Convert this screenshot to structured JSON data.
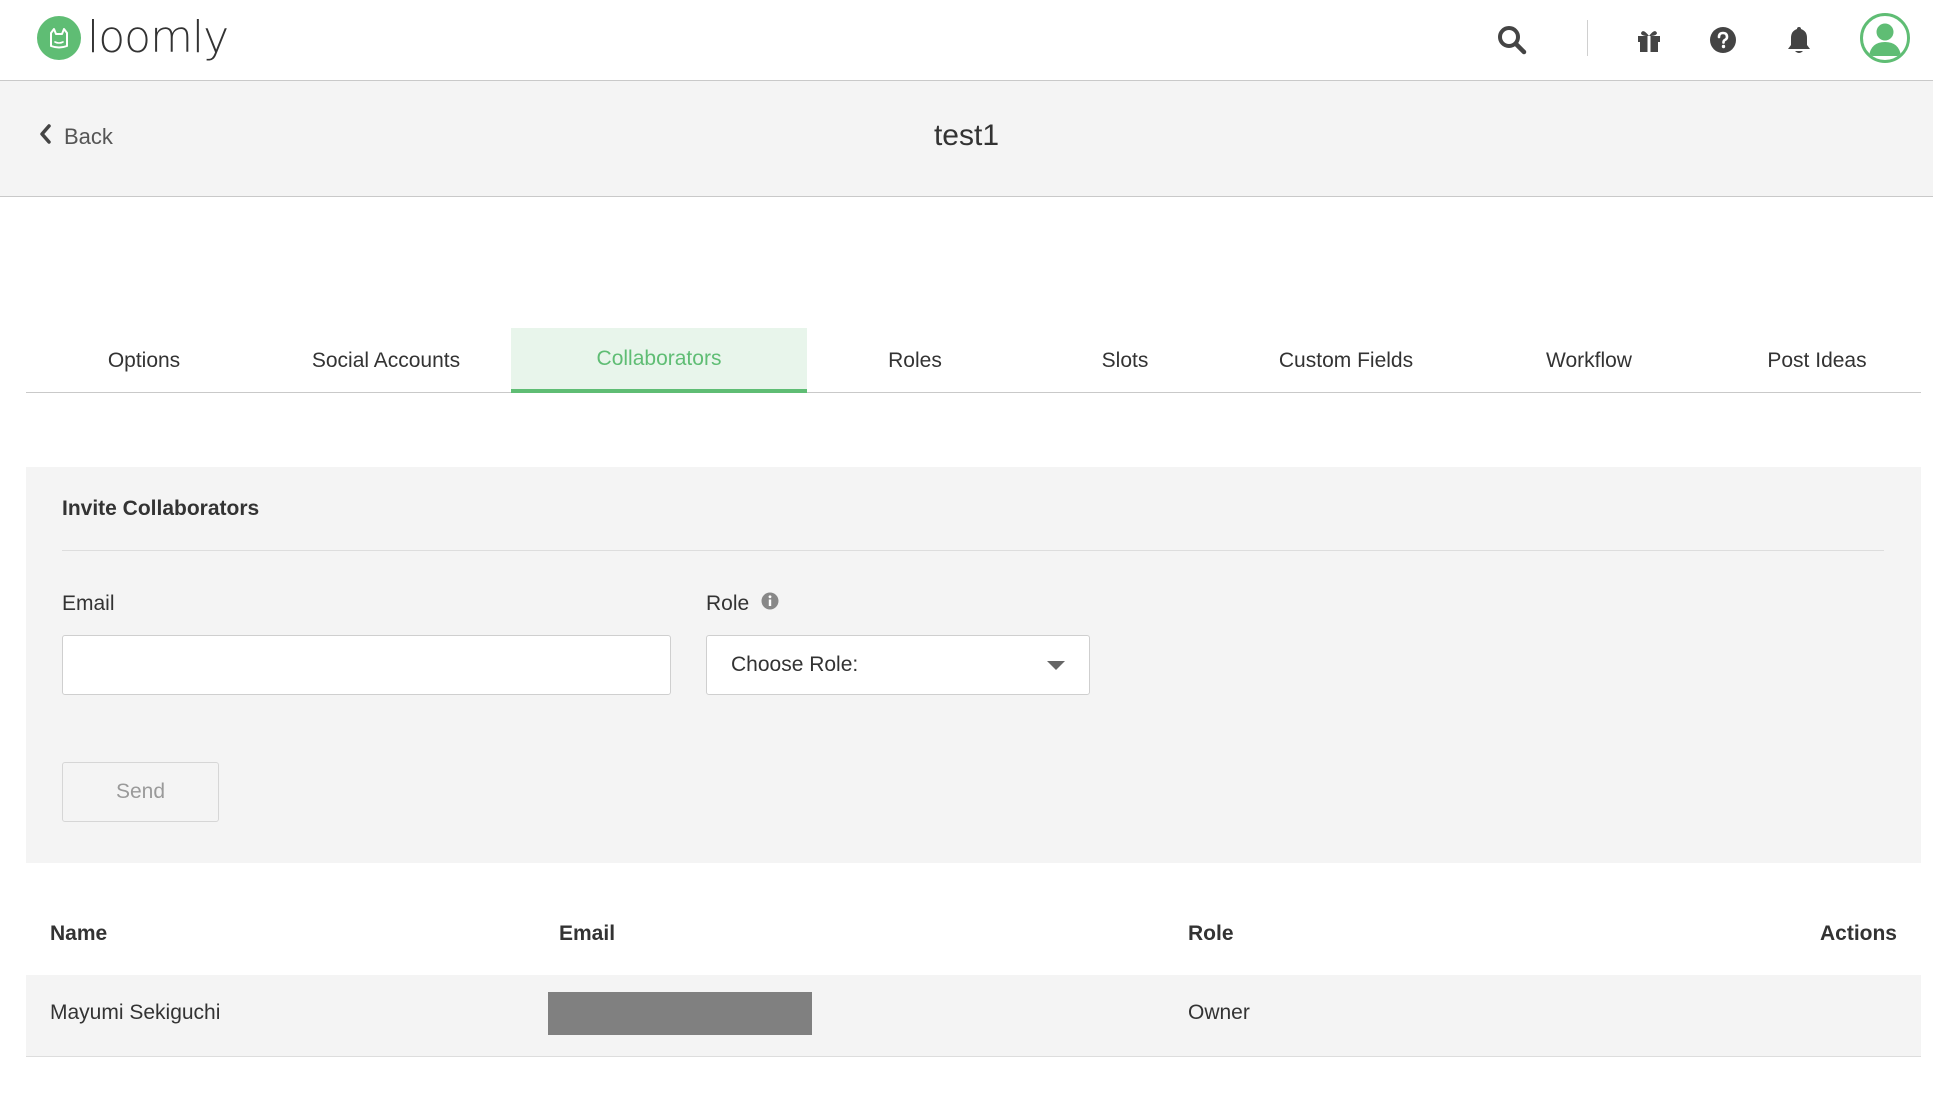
{
  "app": {
    "logo_text": "loomly",
    "brand_color": "#5fbd74"
  },
  "topbar": {
    "icons": [
      "search-icon",
      "gift-icon",
      "help-icon",
      "bell-icon",
      "user-avatar-icon"
    ]
  },
  "subheader": {
    "back_label": "Back",
    "title": "test1"
  },
  "tabs": [
    {
      "label": "Options",
      "active": false
    },
    {
      "label": "Social Accounts",
      "active": false
    },
    {
      "label": "Collaborators",
      "active": true
    },
    {
      "label": "Roles",
      "active": false
    },
    {
      "label": "Slots",
      "active": false
    },
    {
      "label": "Custom Fields",
      "active": false
    },
    {
      "label": "Workflow",
      "active": false
    },
    {
      "label": "Post Ideas",
      "active": false
    }
  ],
  "invite": {
    "title": "Invite Collaborators",
    "email_label": "Email",
    "email_value": "",
    "role_label": "Role",
    "role_selected": "Choose Role:",
    "send_label": "Send"
  },
  "table": {
    "headers": {
      "name": "Name",
      "email": "Email",
      "role": "Role",
      "actions": "Actions"
    },
    "rows": [
      {
        "name": "Mayumi Sekiguchi",
        "email_redacted": true,
        "role": "Owner"
      }
    ]
  }
}
